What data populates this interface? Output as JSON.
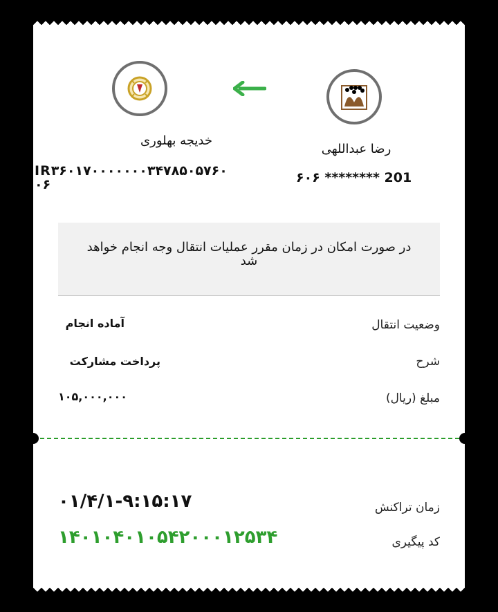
{
  "source": {
    "name": "رضا عبداللهی",
    "account": "۶۰۶ ******** 201",
    "bank_icon": "bank-sepah-logo-icon"
  },
  "destination": {
    "name": "خدیجه بهلوری",
    "account_line1": "IR۳۶۰۱۷۰۰۰۰۰۰۰۳۴۷۸۵۰۵۷۶۰",
    "account_line2": "۰۶",
    "bank_icon": "bank-melli-logo-icon"
  },
  "arrow_icon": "arrow-left-icon",
  "notice": "در صورت امکان در زمان مقرر عملیات انتقال وجه انجام خواهد شد",
  "details": {
    "status_label": "وضعیت انتقال",
    "status_value": "آماده انجام",
    "description_label": "شرح",
    "description_value": "پرداخت مشارکت",
    "amount_label": "مبلغ (ریال)",
    "amount_value": "۱۰۵,۰۰۰,۰۰۰"
  },
  "transaction": {
    "time_label": "زمان تراکنش",
    "time_value": "۰۱/۴/۱-۹:۱۵:۱۷",
    "tracking_label": "کد پیگیری",
    "tracking_value": "۱۴۰۱۰۴۰۱۰۵۴۲۰۰۰۱۲۵۳۴"
  },
  "colors": {
    "accent_green": "#2e9e2e",
    "sepah_brown": "#8a5a2b",
    "melli_gold": "#c9a227"
  }
}
